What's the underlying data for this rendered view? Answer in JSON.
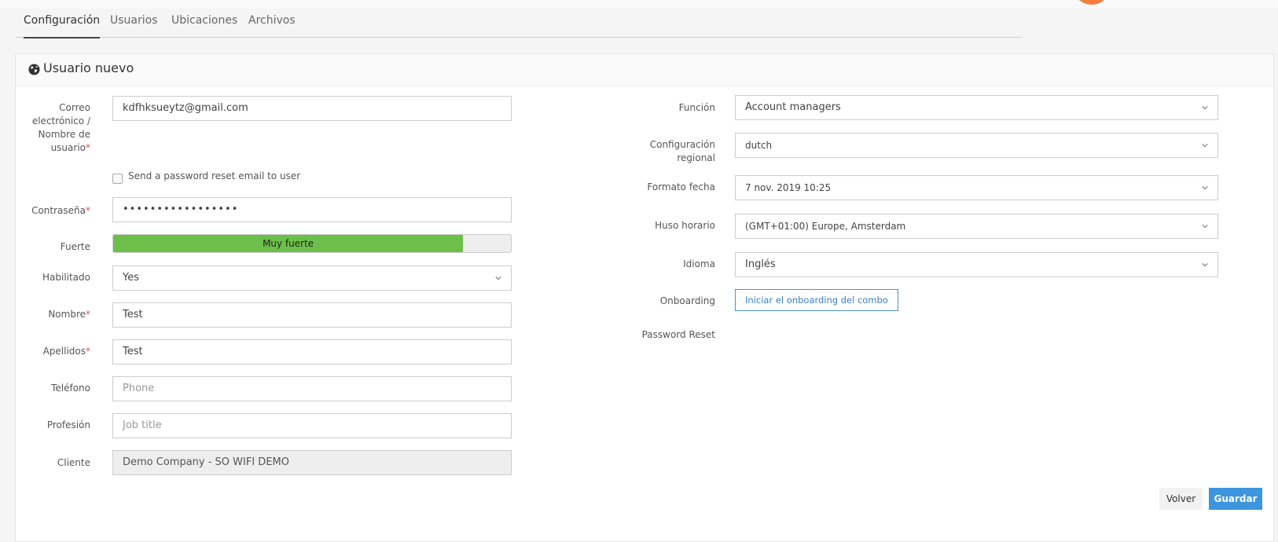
{
  "tabs": [
    {
      "label": "Configuración",
      "active": true
    },
    {
      "label": "Usuarios"
    },
    {
      "label": "Ubicaciones"
    },
    {
      "label": "Archivos"
    }
  ],
  "panel": {
    "title": "Usuario nuevo",
    "icon": "globe-icon"
  },
  "form_left": {
    "email": {
      "label": "Correo electrónico / Nombre de usuario",
      "value": "kdfhksueytz@gmail.com"
    },
    "reset_checkbox": {
      "label": "Send a password reset email to user",
      "checked": false
    },
    "password": {
      "label": "Contraseña",
      "value": "•••••••••••••••••"
    },
    "strength": {
      "label": "Fuerte",
      "text": "Muy fuerte",
      "level_percent": 88
    },
    "enabled": {
      "label": "Habilitado",
      "value": "Yes"
    },
    "first_name": {
      "label": "Nombre",
      "value": "Test"
    },
    "last_name": {
      "label": "Apellidos",
      "value": "Test"
    },
    "phone": {
      "label": "Teléfono",
      "placeholder": "Phone"
    },
    "job": {
      "label": "Profesión",
      "placeholder": "Job title"
    },
    "client": {
      "label": "Cliente",
      "value": "Demo Company - SO WIFI DEMO"
    }
  },
  "form_right": {
    "role": {
      "label": "Función",
      "value": "Account managers"
    },
    "locale": {
      "label": "Configuración regional",
      "value": "dutch"
    },
    "date_format": {
      "label": "Formato fecha",
      "value": "7 nov. 2019 10:25"
    },
    "timezone": {
      "label": "Huso horario",
      "value": "(GMT+01:00) Europe, Amsterdam"
    },
    "language": {
      "label": "Idioma",
      "value": "Inglés"
    },
    "onboarding": {
      "label": "Onboarding",
      "button": "Iniciar el onboarding del combo"
    },
    "password_reset": {
      "label": "Password Reset"
    }
  },
  "actions": {
    "back": "Volver",
    "save": "Guardar"
  },
  "colors": {
    "accent": "#3c95dd",
    "strength_bar": "#6cc04a",
    "required": "#d9534f",
    "brand_dot": "#f47c3c"
  }
}
